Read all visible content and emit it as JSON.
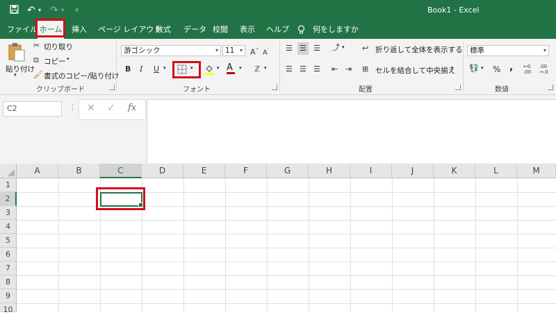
{
  "app": {
    "document_title": "Book1 - Excel"
  },
  "quick_access": {
    "save_icon": "save-icon",
    "undo_icon": "undo-icon",
    "redo_icon": "redo-icon"
  },
  "tabs": [
    {
      "label": "ファイル",
      "active": false
    },
    {
      "label": "ホーム",
      "active": true
    },
    {
      "label": "挿入",
      "active": false
    },
    {
      "label": "ページ レイアウト",
      "active": false
    },
    {
      "label": "数式",
      "active": false
    },
    {
      "label": "データ",
      "active": false
    },
    {
      "label": "校閲",
      "active": false
    },
    {
      "label": "表示",
      "active": false
    },
    {
      "label": "ヘルプ",
      "active": false
    }
  ],
  "tell_me": "何をしますか",
  "ribbon": {
    "clipboard": {
      "group_label": "クリップボード",
      "paste": "貼り付け",
      "cut": "切り取り",
      "copy": "コピー",
      "format_painter": "書式のコピー/貼り付け"
    },
    "font": {
      "group_label": "フォント",
      "font_name": "游ゴシック",
      "font_size": "11",
      "bold": "B",
      "italic": "I",
      "underline": "U"
    },
    "alignment": {
      "group_label": "配置",
      "wrap_text": "折り返して全体を表示する",
      "merge_center": "セルを結合して中央揃え"
    },
    "number": {
      "group_label": "数値",
      "format": "標準",
      "percent": "%",
      "comma": ","
    }
  },
  "formula_bar": {
    "name_box": "C2",
    "formula_value": ""
  },
  "sheet": {
    "columns": [
      "A",
      "B",
      "C",
      "D",
      "E",
      "F",
      "G",
      "H",
      "I",
      "J",
      "K",
      "L",
      "M"
    ],
    "rows": [
      "1",
      "2",
      "3",
      "4",
      "5",
      "6",
      "7",
      "8",
      "9",
      "10"
    ],
    "selected_column": "C",
    "selected_row": "2"
  },
  "colors": {
    "excel_green": "#217346",
    "highlight_red": "#d0101a",
    "fill_yellow": "#ffff00",
    "font_red": "#c00000"
  }
}
